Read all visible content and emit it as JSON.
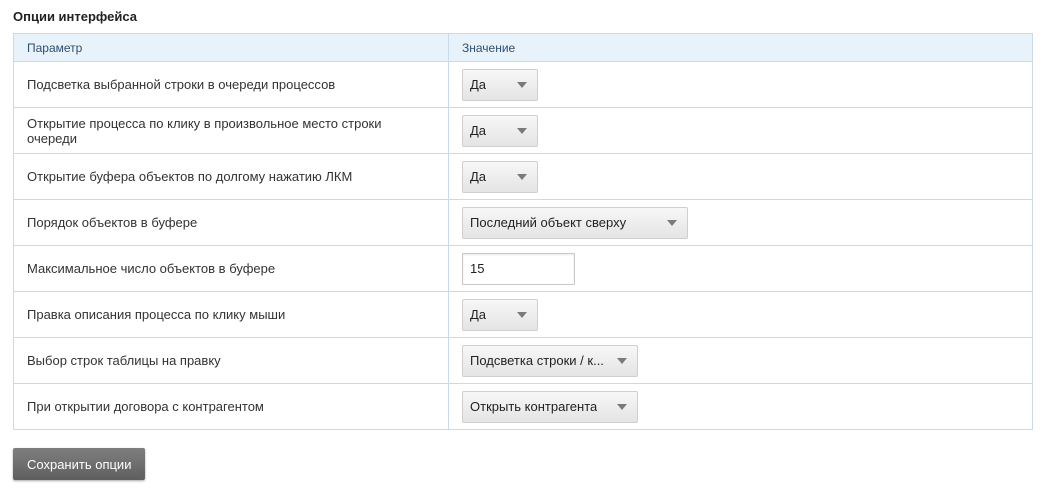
{
  "section": {
    "title": "Опции интерфейса"
  },
  "table": {
    "headers": {
      "param": "Параметр",
      "value": "Значение"
    },
    "rows": [
      {
        "label": "Подсветка выбранной строки в очереди процессов",
        "value": "Да"
      },
      {
        "label": "Открытие процесса по клику в произвольное место строки очереди",
        "value": "Да"
      },
      {
        "label": "Открытие буфера объектов по долгому нажатию ЛКМ",
        "value": "Да"
      },
      {
        "label": "Порядок объектов в буфере",
        "value": "Последний объект сверху"
      },
      {
        "label": "Максимальное число объектов в буфере",
        "value": "15"
      },
      {
        "label": "Правка описания процесса по клику мыши",
        "value": "Да"
      },
      {
        "label": "Выбор строк таблицы на правку",
        "value": "Подсветка строки / к..."
      },
      {
        "label": "При открытии договора с контрагентом",
        "value": "Открыть контрагента"
      }
    ]
  },
  "actions": {
    "save_label": "Сохранить опции"
  },
  "icons": {
    "dropdown": "chevron-down-icon"
  },
  "colors": {
    "header_bg": "#e8f2fa",
    "border": "#c9dbe8",
    "button_bg": "#6e6e6e"
  }
}
